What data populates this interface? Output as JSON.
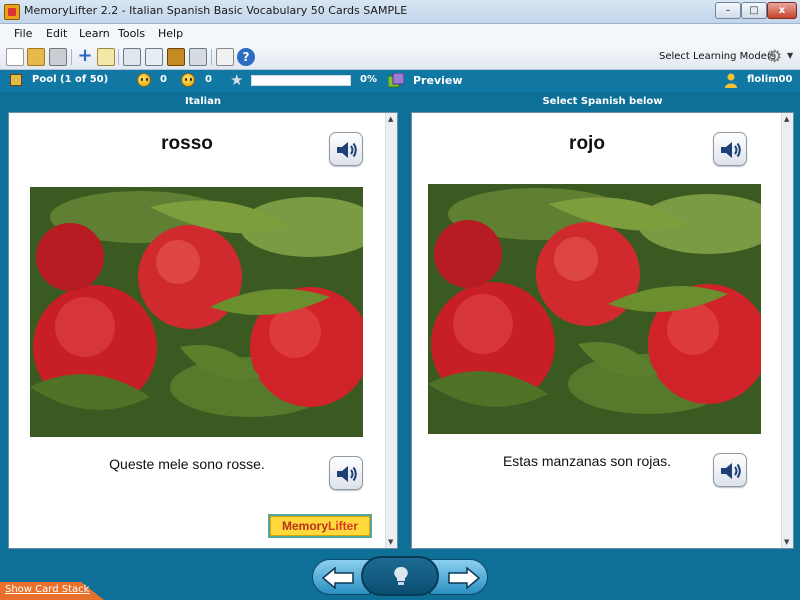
{
  "window": {
    "title": "MemoryLifter 2.2 - Italian Spanish Basic Vocabulary 50 Cards SAMPLE",
    "minimize": "–",
    "maximize": "□",
    "close": "x"
  },
  "menu": [
    "File",
    "Edit",
    "Learn",
    "Tools",
    "Help"
  ],
  "toolbar": {
    "mode_label": "Select Learning Mode(s)"
  },
  "status": {
    "pool_label": "Pool",
    "pool_count": "(1 of 50)",
    "correct": "0",
    "wrong": "0",
    "progress_text": "0%",
    "progress_fraction": 0.0,
    "preview_label": "Preview",
    "user": "flolim00"
  },
  "columns": {
    "question_header": "Italian",
    "answer_header": "Select Spanish below"
  },
  "question_card": {
    "word": "rosso",
    "sentence": "Queste mele sono rosse."
  },
  "answer_card": {
    "word": "rojo",
    "sentence": "Estas manzanas son rojas."
  },
  "logo": {
    "text_prefix": "Memory",
    "text_accent": "Lifter"
  },
  "footer": {
    "show_card_stack": "Show Card Stack"
  }
}
